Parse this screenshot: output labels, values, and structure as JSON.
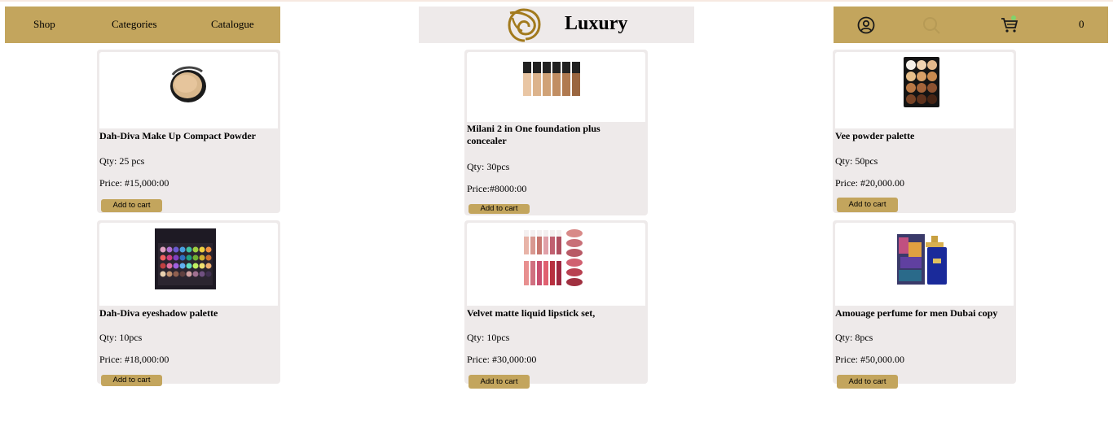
{
  "nav": {
    "links": [
      "Shop",
      "Categories",
      "Catalogue"
    ]
  },
  "brand": {
    "name": "Luxury",
    "logo_icon": "rose-logo-icon"
  },
  "header_right": {
    "icons": [
      "user-icon",
      "search-icon",
      "cart-icon"
    ],
    "cart_count": "0"
  },
  "colors": {
    "accent": "#c3a55d",
    "card_bg": "#eeeaea",
    "logo_gold": "#a27a1d"
  },
  "products": [
    {
      "title": "Dah-Diva Make Up Compact Powder",
      "qty": "Qty: 25 pcs",
      "price": "Price: #15,000:00",
      "button": "Add to cart",
      "image_icon": "compact-powder-image"
    },
    {
      "title": "Milani 2 in One foundation plus concealer",
      "qty": "Qty: 30pcs",
      "price": "Price:#8000:00",
      "button": "Add to cart",
      "image_icon": "foundation-bottles-image"
    },
    {
      "title": "Vee powder palette",
      "qty": "Qty: 50pcs",
      "price": "Price: #20,000.00",
      "button": "Add to cart",
      "image_icon": "powder-palette-image"
    },
    {
      "title": "Dah-Diva eyeshadow palette",
      "qty": "Qty: 10pcs",
      "price": "Price: #18,000:00",
      "button": "Add to cart",
      "image_icon": "eyeshadow-palette-image"
    },
    {
      "title": "Velvet matte liquid lipstick set,",
      "qty": "Qty: 10pcs",
      "price": "Price: #30,000:00",
      "button": "Add to cart",
      "image_icon": "lipstick-set-image"
    },
    {
      "title": "Amouage perfume for men Dubai copy",
      "qty": "Qty: 8pcs",
      "price": "Price: #50,000.00",
      "button": "Add to cart",
      "image_icon": "perfume-image"
    }
  ]
}
